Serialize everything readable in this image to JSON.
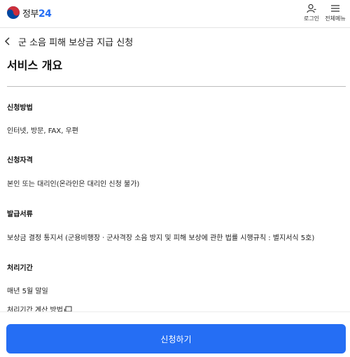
{
  "header": {
    "logo_prefix": "정부",
    "logo_suffix": "24",
    "login_label": "로그인",
    "menu_label": "전체메뉴"
  },
  "page": {
    "title": "군 소음 피해 보상금 지급 신청",
    "section_title": "서비스 개요"
  },
  "items": [
    {
      "label": "신청방법",
      "value": "인터넷, 방문, FAX, 우편"
    },
    {
      "label": "신청자격",
      "value": "본인 또는 대리인(온라인은 대리인 신청 불가)"
    },
    {
      "label": "발급서류",
      "value": "보상금 결정 통지서 (군용비행장ㆍ군사격장 소음 방지 및 피해 보상에 관한 법률 시행규칙 : 별지서식 5호)"
    },
    {
      "label": "처리기간",
      "value": "매년 5월 말일"
    }
  ],
  "processing_link": "처리기간 계산 방법",
  "apply_button": "신청하기",
  "colors": {
    "accent": "#256ef4",
    "logo_red": "#cd2e3a",
    "logo_blue": "#0047a0"
  }
}
